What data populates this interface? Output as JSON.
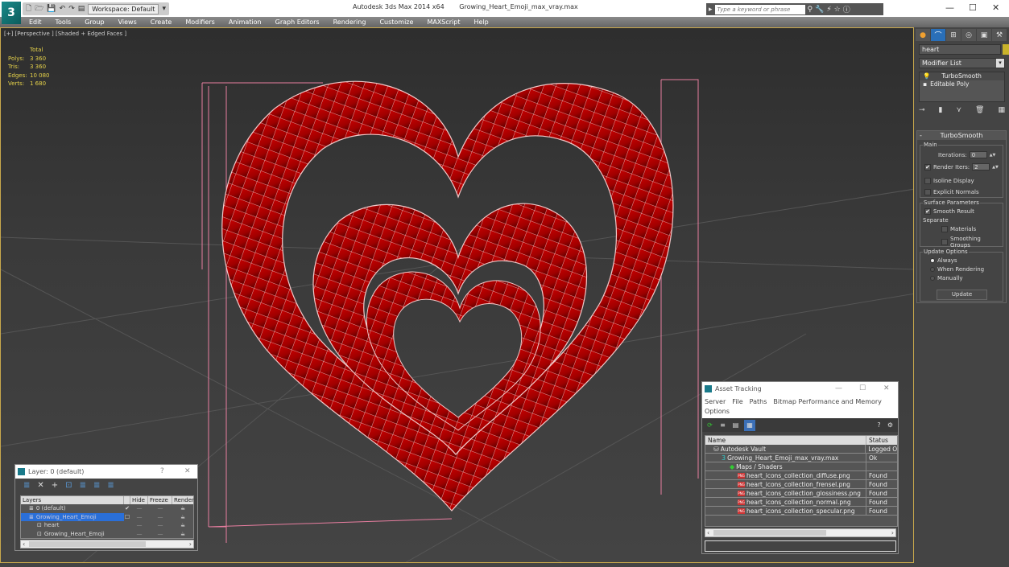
{
  "window": {
    "app_title": "Autodesk 3ds Max  2014 x64",
    "file_title": "Growing_Heart_Emoji_max_vray.max",
    "workspace": "Workspace: Default",
    "search_placeholder": "Type a keyword or phrase",
    "minimize": "—",
    "maximize": "☐",
    "close": "✕"
  },
  "menu": [
    "Edit",
    "Tools",
    "Group",
    "Views",
    "Create",
    "Modifiers",
    "Animation",
    "Graph Editors",
    "Rendering",
    "Customize",
    "MAXScript",
    "Help"
  ],
  "viewport": {
    "label": "[+] [Perspective ] [Shaded + Edged Faces ]",
    "stats_header": "Total",
    "stats": [
      {
        "k": "Polys:",
        "v": "3 360"
      },
      {
        "k": "Tris:",
        "v": "3 360"
      },
      {
        "k": "Edges:",
        "v": "10 080"
      },
      {
        "k": "Verts:",
        "v": "1 680"
      }
    ],
    "object_color": "#b00000",
    "wire_color": "#f0c8c8",
    "bbox_color": "#e87ea0"
  },
  "command_panel": {
    "object_name": "heart",
    "object_color": "#c9b22a",
    "modifier_list": "Modifier List",
    "stack": [
      "TurboSmooth",
      "Editable Poly"
    ],
    "rollout_title": "TurboSmooth",
    "main_group": "Main",
    "iterations_label": "Iterations:",
    "iterations_value": "0",
    "render_iters_label": "Render Iters:",
    "render_iters_value": "2",
    "render_iters_checked": "✔",
    "isoline_label": "Isoline Display",
    "explicit_normals_label": "Explicit Normals",
    "surface_group": "Surface Parameters",
    "smooth_result_label": "Smooth Result",
    "smooth_result_checked": "✔",
    "separate_label": "Separate",
    "materials_label": "Materials",
    "smoothing_groups_label": "Smoothing Groups",
    "update_group": "Update Options",
    "update_options": [
      "Always",
      "When Rendering",
      "Manually"
    ],
    "update_selected": "Always",
    "update_button": "Update"
  },
  "asset_tracking": {
    "title": "Asset Tracking",
    "menu": [
      "Server",
      "File",
      "Paths",
      "Bitmap Performance and Memory",
      "Options"
    ],
    "columns": [
      "Name",
      "Status"
    ],
    "rows": [
      {
        "name": "Autodesk Vault",
        "status": "Logged O",
        "indent": 0,
        "icon": "vault"
      },
      {
        "name": "Growing_Heart_Emoji_max_vray.max",
        "status": "Ok",
        "indent": 1,
        "icon": "max"
      },
      {
        "name": "Maps / Shaders",
        "status": "",
        "indent": 2,
        "icon": "maps"
      },
      {
        "name": "heart_icons_collection_diffuse.png",
        "status": "Found",
        "indent": 3,
        "icon": "png"
      },
      {
        "name": "heart_icons_collection_frensel.png",
        "status": "Found",
        "indent": 3,
        "icon": "png"
      },
      {
        "name": "heart_icons_collection_glossiness.png",
        "status": "Found",
        "indent": 3,
        "icon": "png"
      },
      {
        "name": "heart_icons_collection_normal.png",
        "status": "Found",
        "indent": 3,
        "icon": "png"
      },
      {
        "name": "heart_icons_collection_specular.png",
        "status": "Found",
        "indent": 3,
        "icon": "png"
      }
    ]
  },
  "layer_dialog": {
    "title": "Layer: 0 (default)",
    "help": "?",
    "close": "✕",
    "columns": [
      "Layers",
      "Hide",
      "Freeze",
      "Render"
    ],
    "rows": [
      {
        "name": "0 (default)",
        "mark": "✔",
        "selected": false,
        "indent": 1
      },
      {
        "name": "Growing_Heart_Emoji",
        "mark": "☐",
        "selected": true,
        "indent": 1
      },
      {
        "name": "heart",
        "mark": "",
        "selected": false,
        "indent": 2
      },
      {
        "name": "Growing_Heart_Emoji",
        "mark": "",
        "selected": false,
        "indent": 2
      }
    ]
  }
}
